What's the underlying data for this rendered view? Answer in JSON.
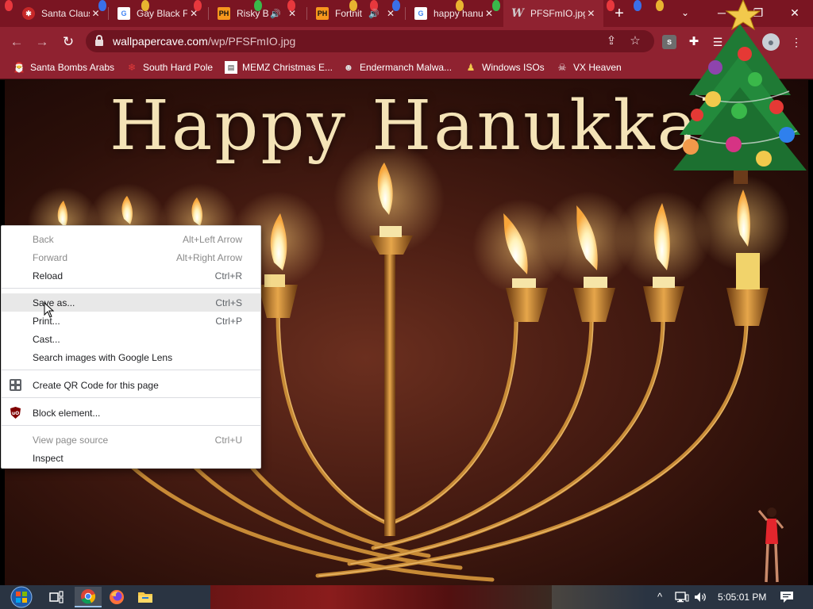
{
  "browser": {
    "tabs": [
      {
        "title": "Santa Claus",
        "favicon": "christmas-icon"
      },
      {
        "title": "Gay Black F",
        "favicon": "google-icon"
      },
      {
        "title": "Risky B",
        "favicon": "ph-icon",
        "favicon_text": "PH"
      },
      {
        "title": "Fortnit",
        "favicon": "ph-icon",
        "favicon_text": "PH"
      },
      {
        "title": "happy hanu",
        "favicon": "google-icon"
      },
      {
        "title": "PFSFmIO.jpg",
        "favicon": "wallpapercave-icon",
        "favicon_text": "W",
        "active": true
      }
    ],
    "new_tab": "+",
    "window_controls": {
      "minimize": "─",
      "maximize": "❐",
      "close": "✕"
    },
    "toolbar": {
      "back": "←",
      "forward": "→",
      "reload": "↻",
      "url_host": "wallpapercave.com",
      "url_path": "/wp/PFSFmIO.jpg",
      "extension_badge": "s"
    },
    "bookmarks": [
      {
        "label": "Santa Bombs Arabs",
        "icon": "santa-icon"
      },
      {
        "label": "South Hard Pole",
        "icon": "snowflake-icon"
      },
      {
        "label": "MEMZ Christmas E...",
        "icon": "memz-icon"
      },
      {
        "label": "Endermanch Malwa...",
        "icon": "endermanch-icon"
      },
      {
        "label": "Windows ISOs",
        "icon": "windows-isos-icon"
      },
      {
        "label": "VX Heaven",
        "icon": "vx-heaven-icon"
      }
    ]
  },
  "page": {
    "image_text": "Happy Hanukkah"
  },
  "context_menu": {
    "items": [
      {
        "label": "Back",
        "shortcut": "Alt+Left Arrow",
        "disabled": true
      },
      {
        "label": "Forward",
        "shortcut": "Alt+Right Arrow",
        "disabled": true
      },
      {
        "label": "Reload",
        "shortcut": "Ctrl+R"
      },
      {
        "label": "Save as...",
        "shortcut": "Ctrl+S",
        "highlighted": true
      },
      {
        "label": "Print...",
        "shortcut": "Ctrl+P"
      },
      {
        "label": "Cast..."
      },
      {
        "label": "Search images with Google Lens"
      },
      {
        "label": "Create QR Code for this page",
        "icon": "qr-code-icon"
      },
      {
        "label": "Block element...",
        "icon": "ublock-icon"
      },
      {
        "label": "View page source",
        "shortcut": "Ctrl+U",
        "disabled": true
      },
      {
        "label": "Inspect"
      }
    ]
  },
  "taskbar": {
    "apps": [
      {
        "name": "task-view-icon"
      },
      {
        "name": "chrome-icon",
        "active": true
      },
      {
        "name": "firefox-icon"
      },
      {
        "name": "file-explorer-icon"
      }
    ],
    "tray": {
      "chevron": "^",
      "network": "network-icon",
      "volume": "volume-icon",
      "notifications": "notifications-icon"
    },
    "clock": "5:05:01 PM"
  },
  "colors": {
    "tab_strip": "#7a1522",
    "toolbar": "#8f2230",
    "omnibox": "#6e1420",
    "menu_highlight": "#e8e8e8",
    "taskbar": "#2a3442"
  }
}
